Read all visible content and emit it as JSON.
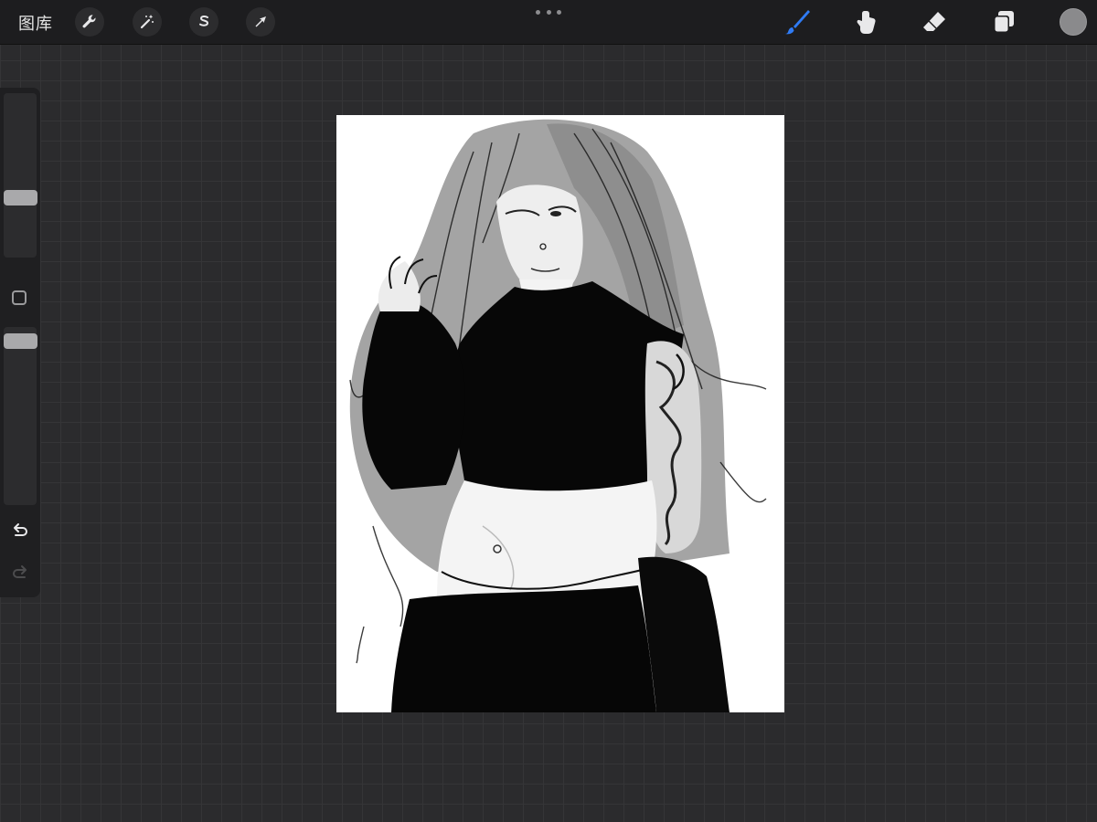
{
  "topbar": {
    "gallery_label": "图库",
    "left_tools": [
      {
        "name": "actions",
        "icon": "wrench-icon"
      },
      {
        "name": "adjustments",
        "icon": "magic-wand-icon"
      },
      {
        "name": "selection",
        "icon": "selection-s-icon"
      },
      {
        "name": "transform",
        "icon": "arrow-cursor-icon"
      }
    ],
    "more_icon": "ellipsis-icon",
    "right_tools": [
      {
        "name": "brush",
        "icon": "brush-icon",
        "active": true,
        "color": "#2f7bf5"
      },
      {
        "name": "smudge",
        "icon": "smudge-finger-icon"
      },
      {
        "name": "eraser",
        "icon": "eraser-icon"
      },
      {
        "name": "layers",
        "icon": "layers-icon"
      }
    ],
    "current_color": "#8a8a8c"
  },
  "sidebar": {
    "brush_size_level": 0.35,
    "opacity_level": 0.96,
    "modifier_icon": "square-modifier-icon",
    "undo_icon": "undo-icon",
    "redo_icon": "redo-icon"
  },
  "canvas": {
    "background": "#ffffff",
    "artwork": "ink-sketch-illustration"
  }
}
